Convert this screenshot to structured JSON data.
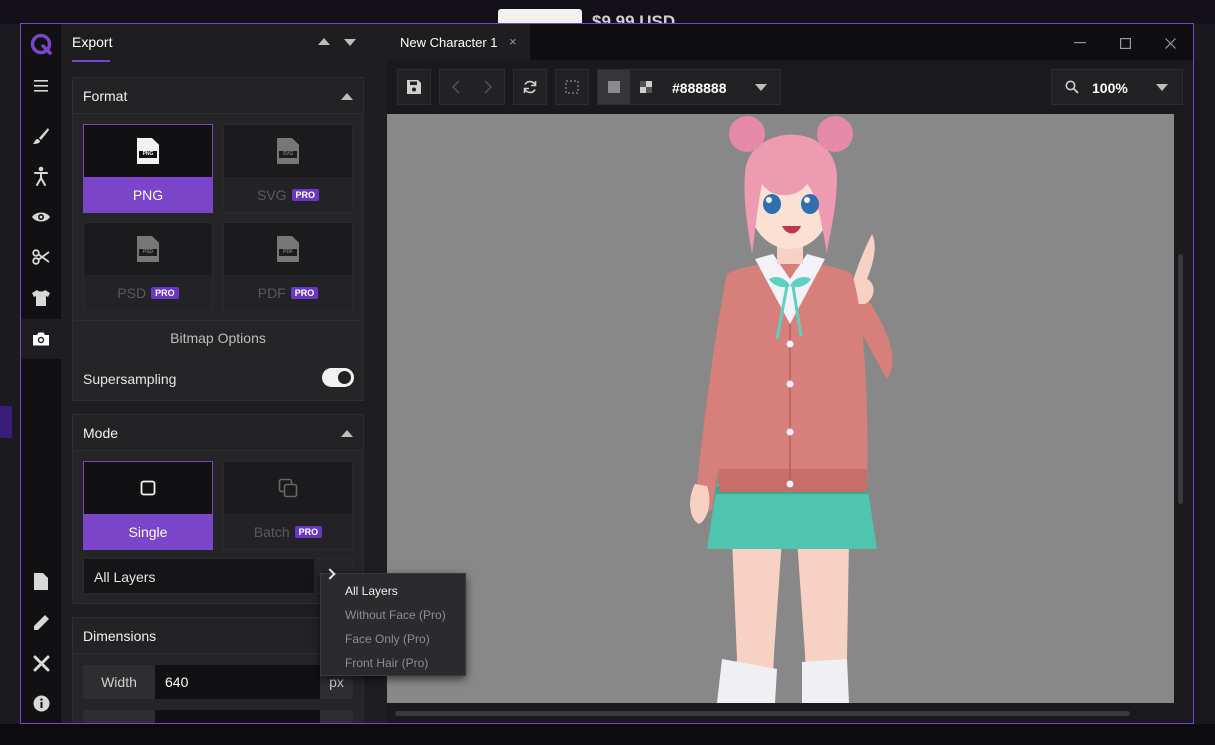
{
  "background": {
    "price_partial": "$9.99 USD"
  },
  "rail": {
    "icons": [
      "logo-icon",
      "menu-icon",
      "brush-icon",
      "pose-icon",
      "eye-icon",
      "scissors-icon",
      "shirt-icon",
      "camera-icon",
      "file-icon",
      "pencil-icon",
      "tools-icon",
      "info-icon"
    ],
    "active": "camera-icon"
  },
  "panel": {
    "title": "Export",
    "format": {
      "title": "Format",
      "options": [
        {
          "label": "PNG",
          "icon_text": "PNG",
          "selected": true,
          "pro": false
        },
        {
          "label": "SVG",
          "icon_text": "SVG",
          "selected": false,
          "pro": true
        },
        {
          "label": "PSD",
          "icon_text": "PSD",
          "selected": false,
          "pro": true
        },
        {
          "label": "PDF",
          "icon_text": "PDF",
          "selected": false,
          "pro": true
        }
      ],
      "pro_badge": "PRO",
      "bitmap_options": "Bitmap Options",
      "supersampling_label": "Supersampling",
      "supersampling_on": true
    },
    "mode": {
      "title": "Mode",
      "options": [
        {
          "label": "Single",
          "selected": true,
          "pro": false
        },
        {
          "label": "Batch",
          "selected": false,
          "pro": true
        }
      ],
      "layers_value": "All Layers"
    },
    "dimensions": {
      "title": "Dimensions",
      "width_label": "Width",
      "width_value": "640",
      "unit": "px"
    }
  },
  "dropdown": {
    "items": [
      "All Layers",
      "Without Face (Pro)",
      "Face Only (Pro)",
      "Front Hair (Pro)"
    ]
  },
  "editor": {
    "tab_title": "New Character 1",
    "tab_close": "×",
    "background_color": "#888888",
    "zoom": "100%"
  },
  "colors": {
    "accent": "#7a45c9",
    "panel": "#1e1e20",
    "canvas": "#888888"
  }
}
